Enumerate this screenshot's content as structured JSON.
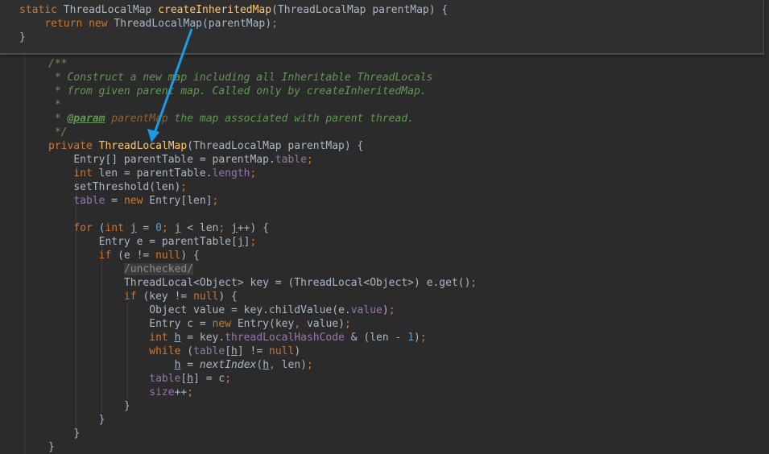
{
  "popup": {
    "lines": [
      {
        "indent": 0,
        "tokens": [
          [
            "static ",
            "kw"
          ],
          [
            "ThreadLocalMap ",
            ""
          ],
          [
            "createInheritedMap",
            "fn"
          ],
          [
            "(ThreadLocalMap parentMap) {",
            ""
          ]
        ]
      },
      {
        "indent": 4,
        "tokens": [
          [
            "return new ",
            "kw"
          ],
          [
            "ThreadLocalMap(parentMap)",
            ""
          ],
          [
            ";",
            "kw"
          ]
        ]
      },
      {
        "indent": 0,
        "tokens": [
          [
            "}",
            ""
          ]
        ]
      }
    ]
  },
  "main": {
    "lines": [
      {
        "indent": 0,
        "tokens": [
          [
            "/**",
            "cm"
          ]
        ]
      },
      {
        "indent": 0,
        "tokens": [
          [
            " * Construct a new map including all Inheritable ThreadLocals",
            "cm"
          ]
        ]
      },
      {
        "indent": 0,
        "tokens": [
          [
            " * from given parent map. Called only by createInheritedMap.",
            "cm"
          ]
        ]
      },
      {
        "indent": 0,
        "tokens": [
          [
            " *",
            "cm"
          ]
        ]
      },
      {
        "indent": 0,
        "tokens": [
          [
            " * ",
            "cm"
          ],
          [
            "@param",
            "tag"
          ],
          [
            " ",
            "cm"
          ],
          [
            "parentMap",
            "param"
          ],
          [
            " the map associated with parent thread.",
            "cm"
          ]
        ]
      },
      {
        "indent": 0,
        "tokens": [
          [
            " */",
            "cm"
          ]
        ]
      },
      {
        "indent": 0,
        "tokens": [
          [
            "private ",
            "kw"
          ],
          [
            "ThreadLocalMap",
            "fn"
          ],
          [
            "(ThreadLocalMap parentMap) {",
            ""
          ]
        ]
      },
      {
        "indent": 4,
        "tokens": [
          [
            "Entry[] parentTable = parentMap.",
            ""
          ],
          [
            "table",
            "field"
          ],
          [
            ";",
            "kw"
          ]
        ]
      },
      {
        "indent": 4,
        "tokens": [
          [
            "int ",
            "kw"
          ],
          [
            "len = parentTable.",
            ""
          ],
          [
            "length",
            "field"
          ],
          [
            ";",
            "kw"
          ]
        ]
      },
      {
        "indent": 4,
        "tokens": [
          [
            "setThreshold(len)",
            ""
          ],
          [
            ";",
            "kw"
          ]
        ]
      },
      {
        "indent": 4,
        "tokens": [
          [
            "table",
            "field"
          ],
          [
            " = ",
            ""
          ],
          [
            "new ",
            "kw"
          ],
          [
            "Entry[len]",
            ""
          ],
          [
            ";",
            "kw"
          ]
        ]
      },
      {
        "indent": 0,
        "tokens": []
      },
      {
        "indent": 4,
        "tokens": [
          [
            "for ",
            "kw"
          ],
          [
            "(",
            ""
          ],
          [
            "int ",
            "kw"
          ],
          [
            "j",
            "u"
          ],
          [
            " = ",
            ""
          ],
          [
            "0",
            "num"
          ],
          [
            "; ",
            "kw"
          ],
          [
            "j",
            "u"
          ],
          [
            " < len",
            ""
          ],
          [
            "; ",
            "kw"
          ],
          [
            "j",
            "u"
          ],
          [
            "++) {",
            ""
          ]
        ]
      },
      {
        "indent": 8,
        "tokens": [
          [
            "Entry e = parentTable[",
            ""
          ],
          [
            "j",
            "u"
          ],
          [
            "]",
            ""
          ],
          [
            ";",
            "kw"
          ]
        ]
      },
      {
        "indent": 8,
        "tokens": [
          [
            "if ",
            "kw"
          ],
          [
            "(e != ",
            ""
          ],
          [
            "null",
            "kw"
          ],
          [
            ") {",
            ""
          ]
        ]
      },
      {
        "indent": 12,
        "tokens": [
          [
            "/unchecked/",
            "hl"
          ]
        ]
      },
      {
        "indent": 12,
        "tokens": [
          [
            "ThreadLocal<Object> key = (ThreadLocal<Object>) e.get()",
            ""
          ],
          [
            ";",
            "kw"
          ]
        ]
      },
      {
        "indent": 12,
        "tokens": [
          [
            "if ",
            "kw"
          ],
          [
            "(key != ",
            ""
          ],
          [
            "null",
            "kw"
          ],
          [
            ") {",
            ""
          ]
        ]
      },
      {
        "indent": 16,
        "tokens": [
          [
            "Object value = key.childValue(e.",
            ""
          ],
          [
            "value",
            "field"
          ],
          [
            ")",
            ""
          ],
          [
            ";",
            "kw"
          ]
        ]
      },
      {
        "indent": 16,
        "tokens": [
          [
            "Entry c = ",
            ""
          ],
          [
            "new ",
            "kw"
          ],
          [
            "Entry(key",
            ""
          ],
          [
            ", ",
            "kw"
          ],
          [
            "value)",
            ""
          ],
          [
            ";",
            "kw"
          ]
        ]
      },
      {
        "indent": 16,
        "tokens": [
          [
            "int ",
            "kw"
          ],
          [
            "h",
            "u"
          ],
          [
            " = key.",
            ""
          ],
          [
            "threadLocalHashCode",
            "field"
          ],
          [
            " & (len - ",
            ""
          ],
          [
            "1",
            "num"
          ],
          [
            ")",
            ""
          ],
          [
            ";",
            "kw"
          ]
        ]
      },
      {
        "indent": 16,
        "tokens": [
          [
            "while ",
            "kw"
          ],
          [
            "(",
            ""
          ],
          [
            "table",
            "field"
          ],
          [
            "[",
            ""
          ],
          [
            "h",
            "u"
          ],
          [
            "] != ",
            ""
          ],
          [
            "null",
            "kw"
          ],
          [
            ")",
            ""
          ]
        ]
      },
      {
        "indent": 20,
        "tokens": [
          [
            "h",
            "u"
          ],
          [
            " = ",
            ""
          ],
          [
            "nextIndex",
            "it"
          ],
          [
            "(",
            ""
          ],
          [
            "h",
            "u"
          ],
          [
            ", ",
            "kw"
          ],
          [
            "len)",
            ""
          ],
          [
            ";",
            "kw"
          ]
        ]
      },
      {
        "indent": 16,
        "tokens": [
          [
            "table",
            "field"
          ],
          [
            "[",
            ""
          ],
          [
            "h",
            "u"
          ],
          [
            "] = c",
            ""
          ],
          [
            ";",
            "kw"
          ]
        ]
      },
      {
        "indent": 16,
        "tokens": [
          [
            "size",
            "field"
          ],
          [
            "++",
            ""
          ],
          [
            ";",
            "kw"
          ]
        ]
      },
      {
        "indent": 12,
        "tokens": [
          [
            "}",
            ""
          ]
        ]
      },
      {
        "indent": 8,
        "tokens": [
          [
            "}",
            ""
          ]
        ]
      },
      {
        "indent": 4,
        "tokens": [
          [
            "}",
            ""
          ]
        ]
      },
      {
        "indent": 0,
        "tokens": [
          [
            "}",
            ""
          ]
        ]
      }
    ]
  },
  "colors": {
    "arrow": "#1a9be6"
  }
}
